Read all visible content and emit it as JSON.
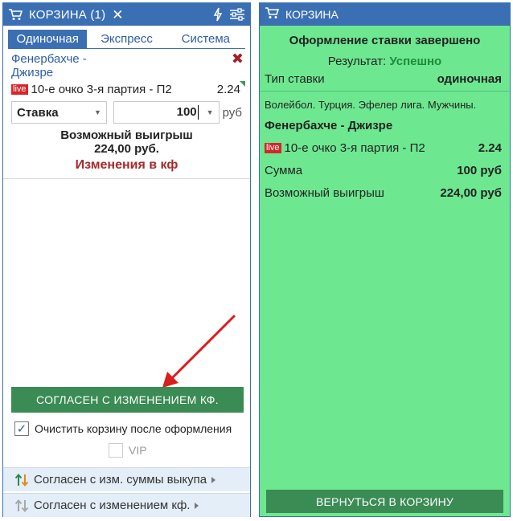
{
  "left": {
    "header": {
      "title": "КОРЗИНА (1)",
      "cart_icon": "cart-icon",
      "close_icon": "close-icon",
      "lightning_icon": "lightning-icon",
      "settings_icon": "sliders-icon"
    },
    "tabs": [
      {
        "label": "Одиночная",
        "active": true
      },
      {
        "label": "Экспресс",
        "active": false
      },
      {
        "label": "Система",
        "active": false
      }
    ],
    "event": {
      "name": "Фенербахче - Джизре"
    },
    "bet": {
      "live": "live",
      "selection": "10-е очко 3-я партия - П2",
      "odds": "2.24"
    },
    "stake": {
      "type": "Ставка",
      "amount": "100",
      "currency": "руб"
    },
    "win": {
      "label": "Возможный выигрыш",
      "amount": "224,00 руб."
    },
    "kf_change": "Изменения в кф",
    "agree_button": "СОГЛАСЕН С ИЗМЕНЕНИЕМ КФ.",
    "clear_cart": {
      "label": "Очистить корзину после оформления",
      "checked": true
    },
    "vip": {
      "label": "VIP",
      "checked": false
    },
    "options": [
      {
        "label": "Согласен с изм. суммы выкупа"
      },
      {
        "label": "Согласен с изменением кф."
      }
    ]
  },
  "right": {
    "header": {
      "title": "КОРЗИНА"
    },
    "title": "Оформление ставки завершено",
    "result": {
      "label": "Результат:",
      "value": "Успешно"
    },
    "type": {
      "label": "Тип ставки",
      "value": "одиночная"
    },
    "sport": "Волейбол. Турция. Эфелер лига. Мужчины.",
    "match": "Фенербахче - Джизре",
    "bet": {
      "live": "live",
      "selection": "10-е очко 3-я партия - П2",
      "odds": "2.24"
    },
    "sum": {
      "label": "Сумма",
      "value": "100 руб"
    },
    "win": {
      "label": "Возможный выигрыш",
      "value": "224,00 руб"
    },
    "back_button": "ВЕРНУТЬСЯ В КОРЗИНУ"
  },
  "colors": {
    "header_blue": "#3b6fb3",
    "success_green": "#6de891",
    "button_green": "#3a8b54",
    "live_red": "#d6262c",
    "kf_red": "#a52a2a"
  }
}
